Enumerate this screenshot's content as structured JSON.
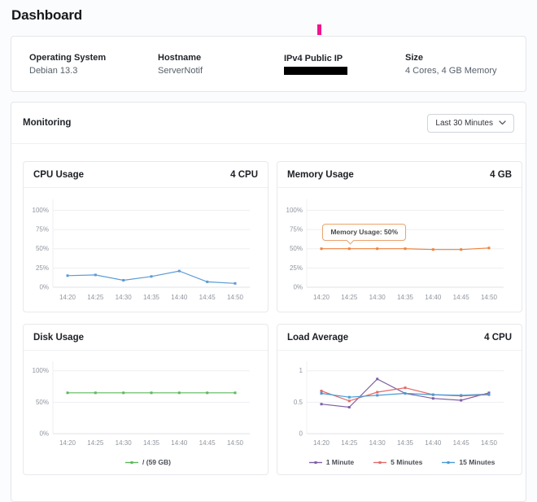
{
  "page": {
    "title": "Dashboard"
  },
  "colors": {
    "caret": "#f2138e",
    "page_background": "#fbfcfd",
    "card_border": "#e3e6ea"
  },
  "info_bar": {
    "items": [
      {
        "label": "Operating System",
        "value": "Debian 13.3"
      },
      {
        "label": "Hostname",
        "value": "ServerNotif"
      },
      {
        "label": "IPv4 Public IP",
        "value": "",
        "redacted": true
      },
      {
        "label": "Size",
        "value": "4 Cores, 4 GB Memory"
      }
    ]
  },
  "monitoring": {
    "title": "Monitoring",
    "time_range_selector": {
      "value": "Last 30 Minutes"
    }
  },
  "chart_data": [
    {
      "id": "cpu-usage",
      "type": "line",
      "title": "CPU Usage",
      "unit_label": "4 CPU",
      "x": [
        "14:20",
        "14:25",
        "14:30",
        "14:35",
        "14:40",
        "14:45",
        "14:50"
      ],
      "y_ticks": [
        {
          "v": 0,
          "label": "0%"
        },
        {
          "v": 25,
          "label": "25%"
        },
        {
          "v": 50,
          "label": "50%"
        },
        {
          "v": 75,
          "label": "75%"
        },
        {
          "v": 100,
          "label": "100%"
        }
      ],
      "ylim": [
        0,
        110
      ],
      "grid": true,
      "show_legend": false,
      "series": [
        {
          "name": "CPU Usage",
          "color": "#5b9bd5",
          "values": [
            15,
            16,
            9,
            14,
            21,
            7,
            5
          ]
        }
      ]
    },
    {
      "id": "memory-usage",
      "type": "line",
      "title": "Memory Usage",
      "unit_label": "4 GB",
      "x": [
        "14:20",
        "14:25",
        "14:30",
        "14:35",
        "14:40",
        "14:45",
        "14:50"
      ],
      "y_ticks": [
        {
          "v": 0,
          "label": "0%"
        },
        {
          "v": 25,
          "label": "25%"
        },
        {
          "v": 50,
          "label": "50%"
        },
        {
          "v": 75,
          "label": "75%"
        },
        {
          "v": 100,
          "label": "100%"
        }
      ],
      "ylim": [
        0,
        110
      ],
      "grid": true,
      "show_legend": false,
      "series": [
        {
          "name": "Memory Usage",
          "color": "#ee823d",
          "values": [
            50,
            50,
            50,
            50,
            49,
            49,
            51
          ]
        }
      ],
      "tooltip": {
        "series": 0,
        "index": 1,
        "text": "Memory Usage: 50%",
        "border_color": "#e9a571"
      }
    },
    {
      "id": "disk-usage",
      "type": "line",
      "title": "Disk Usage",
      "unit_label": "",
      "x": [
        "14:20",
        "14:25",
        "14:30",
        "14:35",
        "14:40",
        "14:45",
        "14:50"
      ],
      "y_ticks": [
        {
          "v": 0,
          "label": "0%"
        },
        {
          "v": 50,
          "label": "50%"
        },
        {
          "v": 100,
          "label": "100%"
        }
      ],
      "ylim": [
        0,
        110
      ],
      "grid": true,
      "show_legend": true,
      "series": [
        {
          "name": "/ (59 GB)",
          "color": "#5cb85c",
          "values": [
            65,
            65,
            65,
            65,
            65,
            65,
            65
          ]
        }
      ]
    },
    {
      "id": "load-average",
      "type": "line",
      "title": "Load Average",
      "unit_label": "4 CPU",
      "x": [
        "14:20",
        "14:25",
        "14:30",
        "14:35",
        "14:40",
        "14:45",
        "14:50"
      ],
      "y_ticks": [
        {
          "v": 0,
          "label": "0"
        },
        {
          "v": 0.5,
          "label": "0.5"
        },
        {
          "v": 1,
          "label": "1"
        }
      ],
      "ylim": [
        0,
        1.1
      ],
      "grid": true,
      "show_legend": true,
      "series": [
        {
          "name": "1 Minute",
          "color": "#7e5fa6",
          "values": [
            0.47,
            0.42,
            0.87,
            0.64,
            0.56,
            0.53,
            0.65
          ]
        },
        {
          "name": "5 Minutes",
          "color": "#e36a6a",
          "values": [
            0.68,
            0.52,
            0.66,
            0.73,
            0.62,
            0.6,
            0.62
          ]
        },
        {
          "name": "15 Minutes",
          "color": "#4a9bd5",
          "values": [
            0.64,
            0.58,
            0.61,
            0.64,
            0.62,
            0.61,
            0.63
          ]
        }
      ]
    }
  ]
}
